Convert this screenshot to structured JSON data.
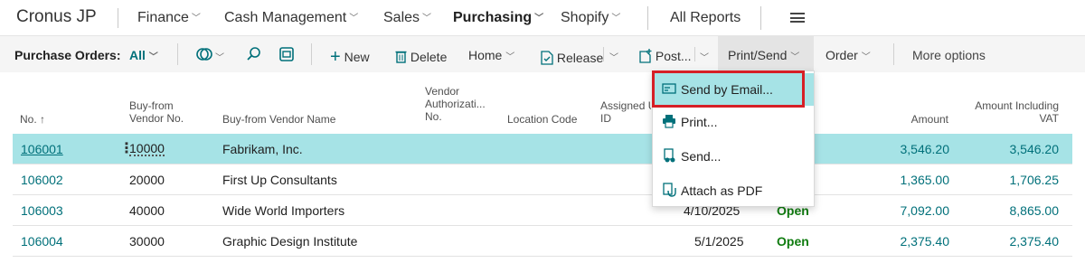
{
  "app": {
    "brand": "Cronus JP"
  },
  "nav": {
    "items": [
      {
        "label": "Finance",
        "chevron": true
      },
      {
        "label": "Cash Management",
        "chevron": true
      },
      {
        "label": "Sales",
        "chevron": true
      },
      {
        "label": "Purchasing",
        "chevron": true,
        "active": true
      },
      {
        "label": "Shopify",
        "chevron": true
      }
    ],
    "all_reports": "All Reports"
  },
  "actions": {
    "page_label": "Purchase Orders:",
    "filter_label": "All",
    "new_label": "New",
    "delete_label": "Delete",
    "home_label": "Home",
    "release_label": "Release",
    "post_label": "Post...",
    "print_send_label": "Print/Send",
    "order_label": "Order",
    "more_label": "More options"
  },
  "columns": {
    "no": "No. ↑",
    "vendor_no_1": "Buy-from",
    "vendor_no_2": "Vendor No.",
    "vendor_name": "Buy-from Vendor Name",
    "vend_auth_1": "Vendor",
    "vend_auth_2": "Authorizati...",
    "vend_auth_3": "No.",
    "location": "Location Code",
    "assigned_1": "Assigned U",
    "assigned_2": "ID",
    "amount": "Amount",
    "amount_vat_1": "Amount Including",
    "amount_vat_2": "VAT"
  },
  "rows": [
    {
      "no": "106001",
      "vendor_no": "10000",
      "vendor_name": "Fabrikam, Inc.",
      "date": "",
      "status": "",
      "amount": "3,546.20",
      "amount_vat": "3,546.20",
      "selected": true
    },
    {
      "no": "106002",
      "vendor_no": "20000",
      "vendor_name": "First Up Consultants",
      "date": "",
      "status": "",
      "amount": "1,365.00",
      "amount_vat": "1,706.25"
    },
    {
      "no": "106003",
      "vendor_no": "40000",
      "vendor_name": "Wide World Importers",
      "date": "4/10/2025",
      "status": "Open",
      "amount": "7,092.00",
      "amount_vat": "8,865.00"
    },
    {
      "no": "106004",
      "vendor_no": "30000",
      "vendor_name": "Graphic Design Institute",
      "date": "5/1/2025",
      "status": "Open",
      "amount": "2,375.40",
      "amount_vat": "2,375.40"
    }
  ],
  "menu": {
    "items": [
      {
        "label": "Send by Email...",
        "icon": "email-icon",
        "highlighted": true
      },
      {
        "label": "Print...",
        "icon": "printer-icon"
      },
      {
        "label": "Send...",
        "icon": "send-document-icon"
      },
      {
        "label": "Attach as PDF",
        "icon": "attach-pdf-icon"
      }
    ]
  },
  "colors": {
    "accent": "#00707a",
    "selected_row": "#a6e3e6",
    "status_open": "#107c10",
    "highlight_box": "#d61f26"
  }
}
